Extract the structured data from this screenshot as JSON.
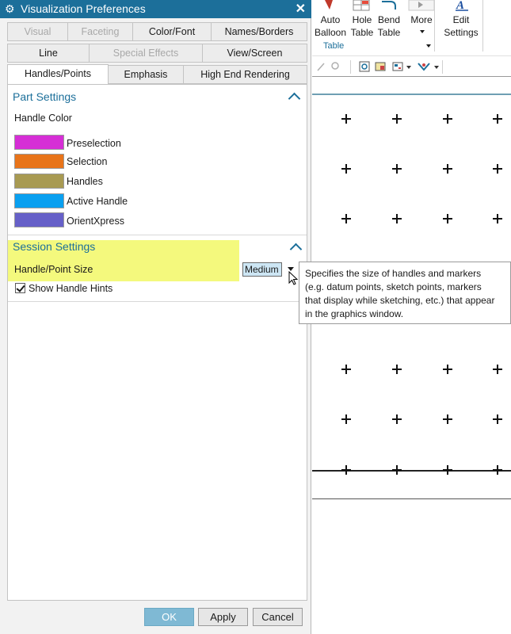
{
  "dialog": {
    "title": "Visualization Preferences",
    "tabs_row1": [
      "Visual",
      "Faceting",
      "Color/Font",
      "Names/Borders"
    ],
    "tabs_row2": [
      "Line",
      "Special Effects",
      "View/Screen"
    ],
    "tabs_row3": [
      "Handles/Points",
      "Emphasis",
      "High End Rendering"
    ],
    "part_settings": {
      "header": "Part Settings",
      "handle_color_label": "Handle Color",
      "colors": [
        {
          "label": "Preselection",
          "color": "#d62ed6"
        },
        {
          "label": "Selection",
          "color": "#e8741a"
        },
        {
          "label": "Handles",
          "color": "#a89a52"
        },
        {
          "label": "Active Handle",
          "color": "#0aa0f0"
        },
        {
          "label": "OrientXpress",
          "color": "#6660c8"
        }
      ]
    },
    "session_settings": {
      "header": "Session Settings",
      "size_label": "Handle/Point Size",
      "size_value": "Medium",
      "show_hints_label": "Show Handle Hints",
      "show_hints_checked": true
    },
    "buttons": {
      "ok": "OK",
      "apply": "Apply",
      "cancel": "Cancel"
    }
  },
  "tooltip": {
    "lines": [
      "Specifies the size of handles and markers",
      "(e.g. datum points, sketch points, markers",
      "that display while sketching, etc.) that appear",
      "in the graphics window."
    ]
  },
  "ribbon": {
    "auto_balloon": [
      "Auto",
      "Balloon"
    ],
    "hole_table": [
      "Hole",
      "Table"
    ],
    "bend_table": [
      "Bend",
      "Table"
    ],
    "more": "More",
    "edit_settings": [
      "Edit",
      "Settings"
    ],
    "group_label": "Table"
  }
}
